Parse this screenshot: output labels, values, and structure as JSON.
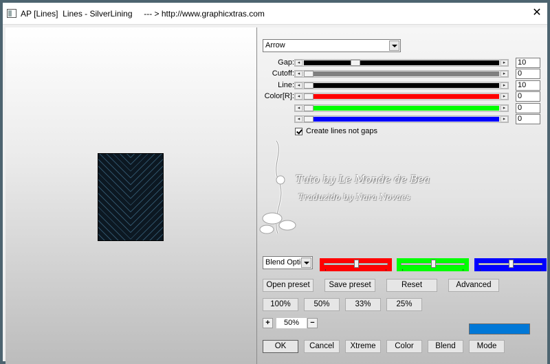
{
  "window": {
    "title": "AP [Lines]  Lines - SilverLining     --- > http://www.graphicxtras.com",
    "close": "✕"
  },
  "controls": {
    "type_select": "Arrow",
    "sliders": [
      {
        "label": "Gap:",
        "value": "10",
        "fill": "#000000",
        "position": 0.25
      },
      {
        "label": "Cutoff:",
        "value": "0",
        "fill": "#808080",
        "position": 0.0
      },
      {
        "label": "Line:",
        "value": "10",
        "fill": "#000000",
        "position": 0.0
      },
      {
        "label": "Color[R]:",
        "value": "0",
        "fill": "#ff0000",
        "position": 0.0
      },
      {
        "label": "",
        "value": "0",
        "fill": "#00ff00",
        "position": 0.0
      },
      {
        "label": "",
        "value": "0",
        "fill": "#0000ff",
        "position": 0.0
      }
    ],
    "checkbox_label": "Create lines not gaps",
    "checkbox_checked": true
  },
  "watermark": {
    "line1": "Tuto by Le Monde de Bea",
    "line2": "Traduzido by Nara Novaes"
  },
  "blend": {
    "select": "Blend Options",
    "color_sliders": [
      {
        "color": "#ff0000",
        "position": 0.5
      },
      {
        "color": "#00ff00",
        "position": 0.5
      },
      {
        "color": "#0000ff",
        "position": 0.5
      }
    ]
  },
  "buttons": {
    "open_preset": "Open preset",
    "save_preset": "Save preset",
    "reset": "Reset",
    "advanced": "Advanced",
    "z100": "100%",
    "z50": "50%",
    "z33": "33%",
    "z25": "25%",
    "ok": "OK",
    "cancel": "Cancel",
    "xtreme": "Xtreme",
    "color": "Color",
    "blend": "Blend",
    "mode": "Mode"
  },
  "zoom": {
    "plus": "+",
    "minus": "−",
    "value": "50%"
  },
  "color_swatch": "#0078d7"
}
